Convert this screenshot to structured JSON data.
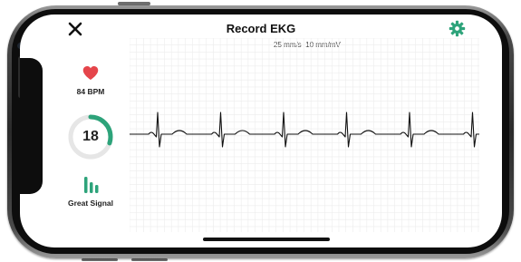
{
  "header": {
    "title": "Record EKG",
    "close_icon": "close-icon",
    "settings_icon": "gear-icon"
  },
  "scale": {
    "speed": "25 mm/s",
    "gain": "10 mm/mV"
  },
  "heart_rate": {
    "label": "84 BPM",
    "icon": "heart-icon",
    "color": "#e5454b"
  },
  "countdown": {
    "value": "18",
    "ring_fraction": 0.3,
    "accent": "#2da37a"
  },
  "signal": {
    "label": "Great Signal",
    "icon": "signal-bars-icon",
    "color": "#2da37a"
  },
  "colors": {
    "accent": "#2da37a",
    "heart": "#e5454b",
    "grid": "#ececec",
    "trace": "#111111"
  }
}
